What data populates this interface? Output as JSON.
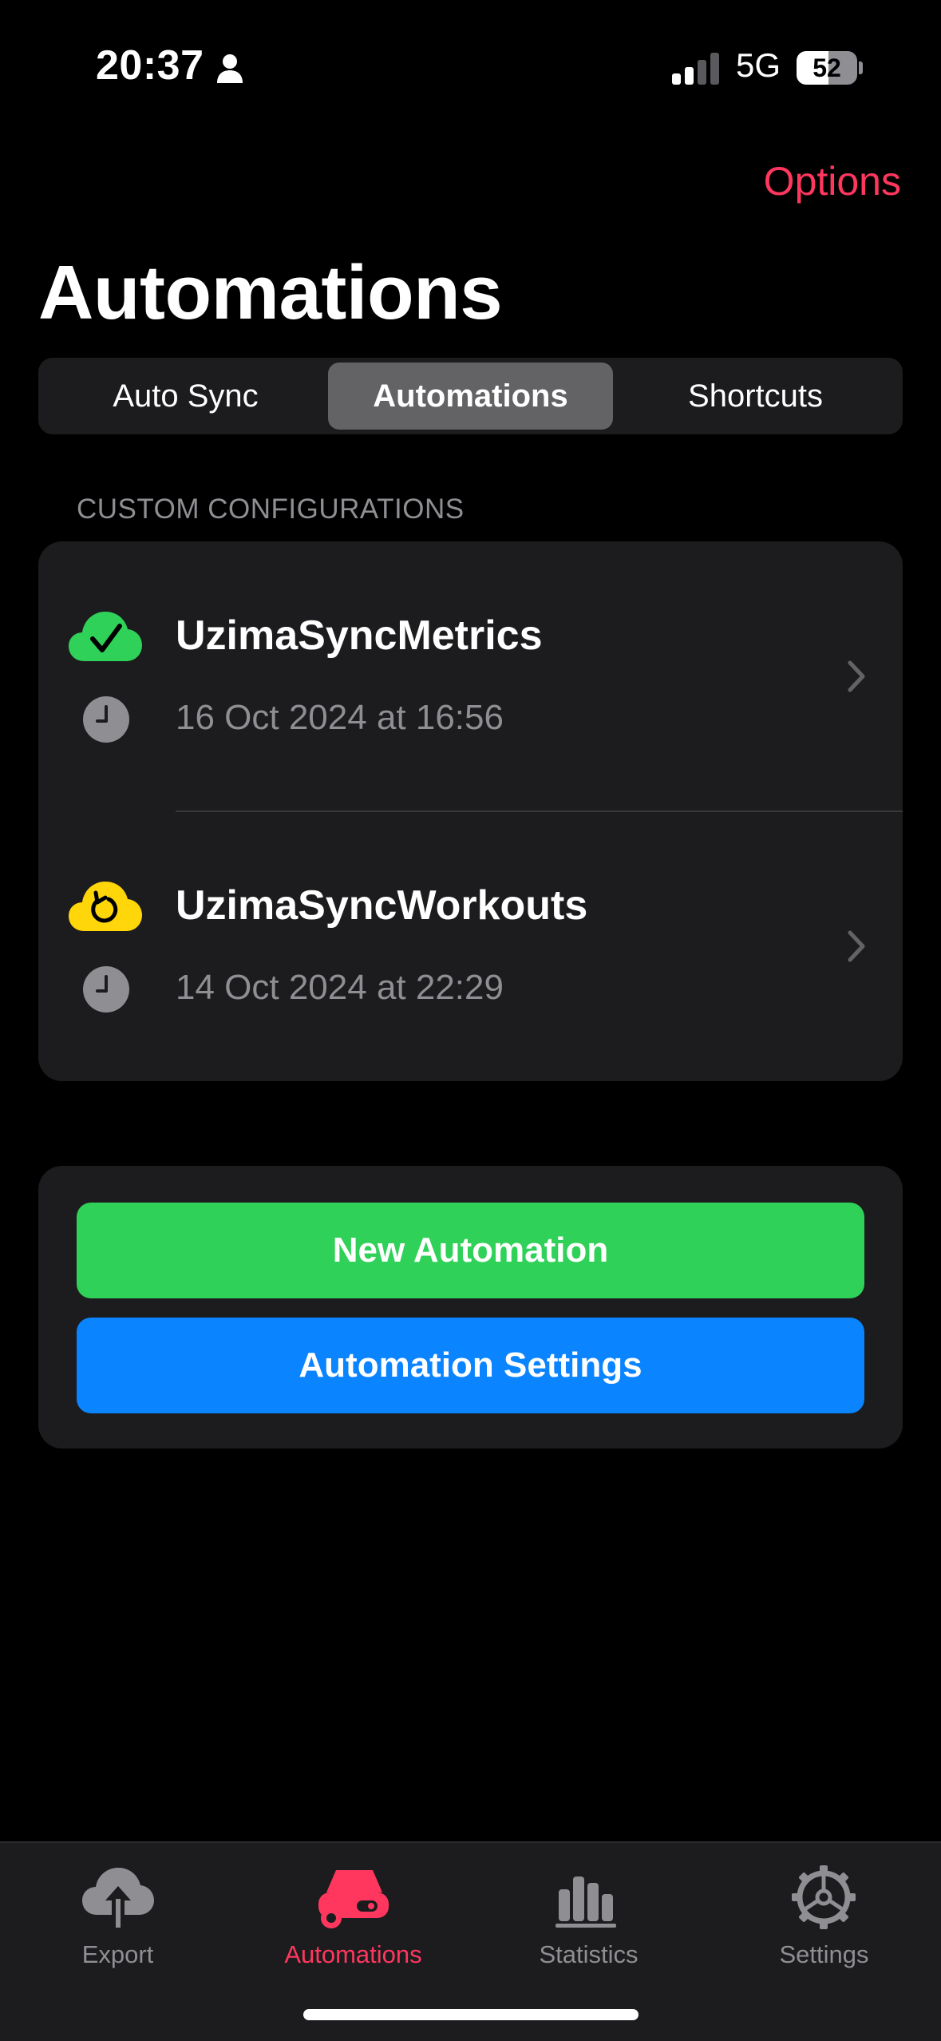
{
  "status_bar": {
    "time": "20:37",
    "network": "5G",
    "battery_level": "52",
    "battery_fraction": 0.52
  },
  "nav": {
    "options_label": "Options",
    "title": "Automations"
  },
  "segments": [
    {
      "label": "Auto Sync",
      "selected": false
    },
    {
      "label": "Automations",
      "selected": true
    },
    {
      "label": "Shortcuts",
      "selected": false
    }
  ],
  "section": {
    "header": "CUSTOM CONFIGURATIONS"
  },
  "configurations": [
    {
      "name": "UzimaSyncMetrics",
      "last_run": "16 Oct 2024 at 16:56",
      "status": "success",
      "status_icon": "cloud-check-icon",
      "status_color": "#30d158"
    },
    {
      "name": "UzimaSyncWorkouts",
      "last_run": "14 Oct 2024 at 22:29",
      "status": "pending",
      "status_icon": "cloud-refresh-icon",
      "status_color": "#ffd60a"
    }
  ],
  "actions": {
    "new_automation": "New Automation",
    "automation_settings": "Automation Settings"
  },
  "tab_bar": [
    {
      "label": "Export",
      "icon": "cloud-upload-icon",
      "active": false
    },
    {
      "label": "Automations",
      "icon": "car-icon",
      "active": true
    },
    {
      "label": "Statistics",
      "icon": "bar-chart-icon",
      "active": false
    },
    {
      "label": "Settings",
      "icon": "gear-icon",
      "active": false
    }
  ],
  "colors": {
    "accent": "#ff375f",
    "success": "#30d158",
    "warning": "#ffd60a",
    "primary_button": "#0a84ff",
    "card": "#1c1c1e",
    "secondary_text": "#8e8e93"
  }
}
